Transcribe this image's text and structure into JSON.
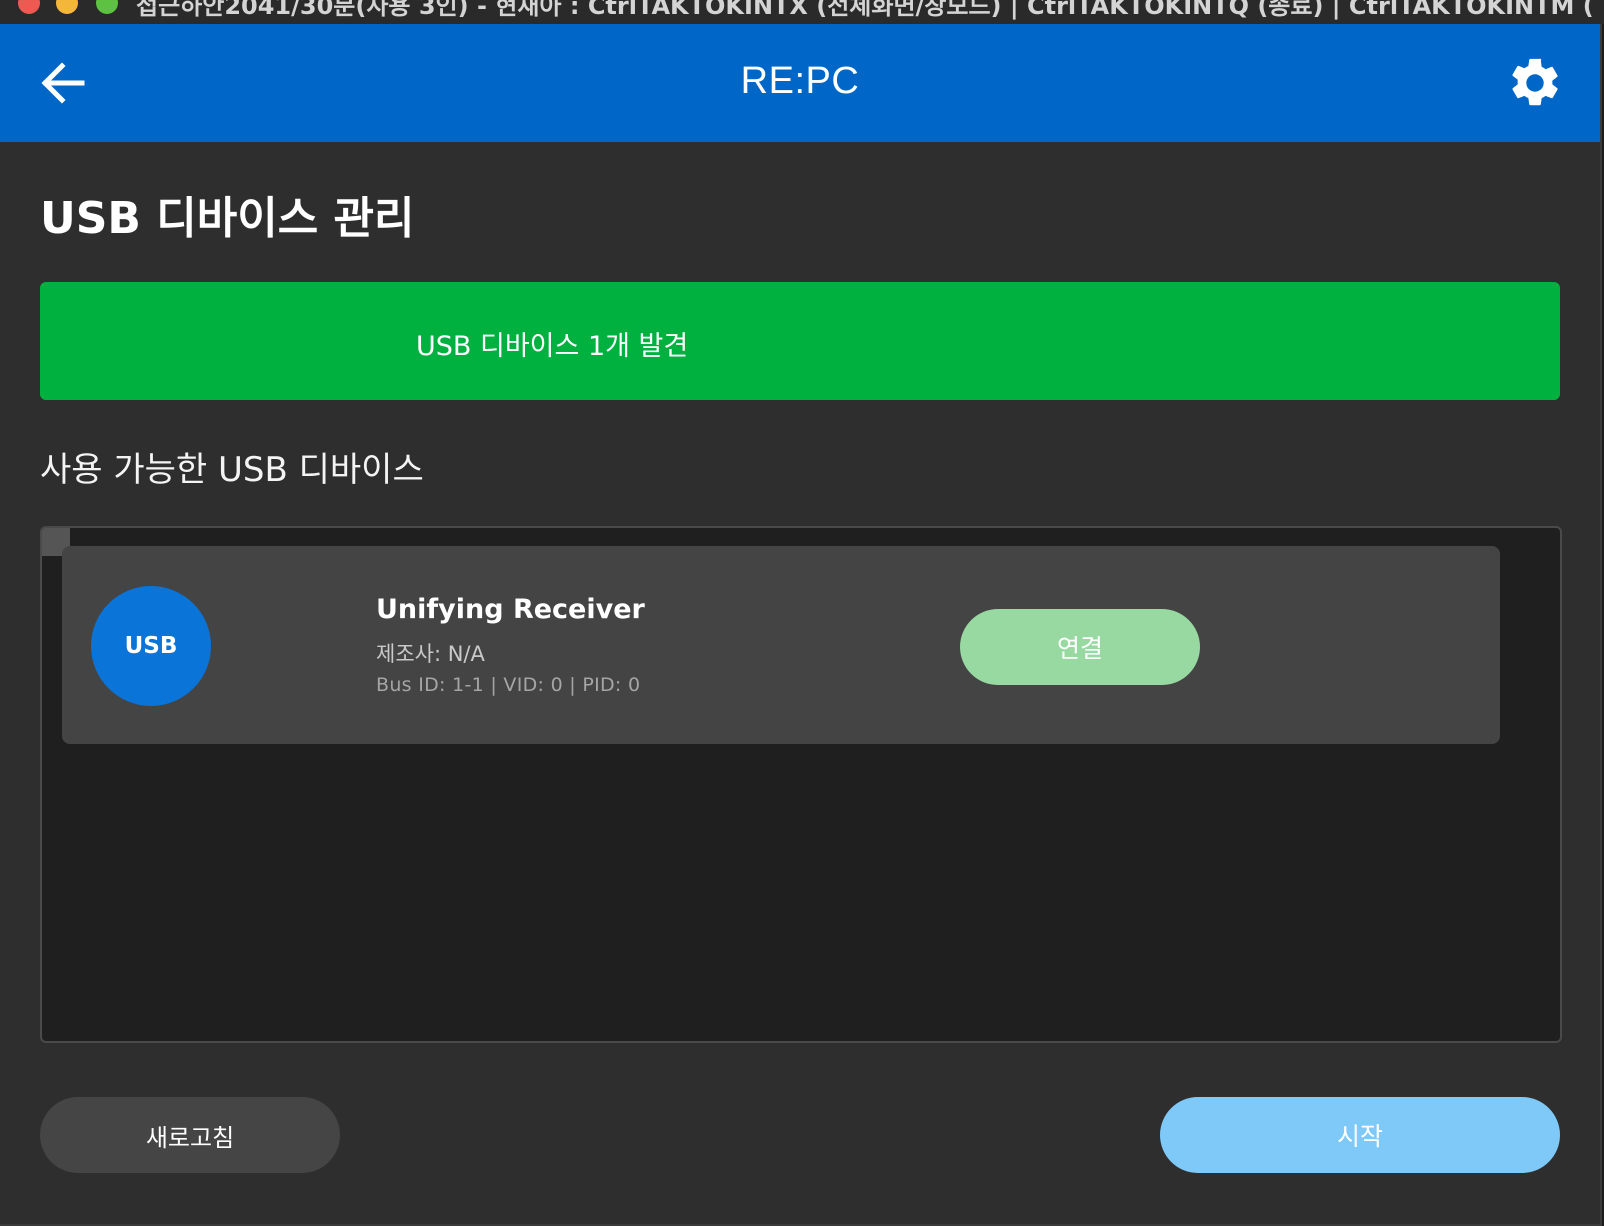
{
  "window": {
    "title": "접근하안2041/30분(사용 3인) - 현재아 : CtrlTAKTOKINTX (전체화면/창모드) | CtrlTAKTOKINTQ (종료) | CtrlTAKTOKINTM ("
  },
  "appbar": {
    "title": "RE:PC",
    "back_icon": "arrow-left-icon",
    "settings_icon": "gear-icon"
  },
  "page": {
    "title": "USB 디바이스 관리"
  },
  "status": {
    "message": "USB 디바이스 1개 발견",
    "color": "#00b140"
  },
  "devices_section": {
    "title": "사용 가능한 USB 디바이스",
    "devices": [
      {
        "icon_label": "USB",
        "name": "Unifying Receiver",
        "manufacturer": "제조사: N/A",
        "ids": "Bus ID: 1-1 | VID: 0 | PID: 0",
        "connect_label": "연결"
      }
    ]
  },
  "footer": {
    "refresh_label": "새로고침",
    "start_label": "시작"
  },
  "colors": {
    "appbar": "#0066c7",
    "background": "#2e2e2e",
    "connect_button": "#97d9a1",
    "start_button": "#7ec9f8",
    "usb_avatar": "#0a74d8"
  }
}
